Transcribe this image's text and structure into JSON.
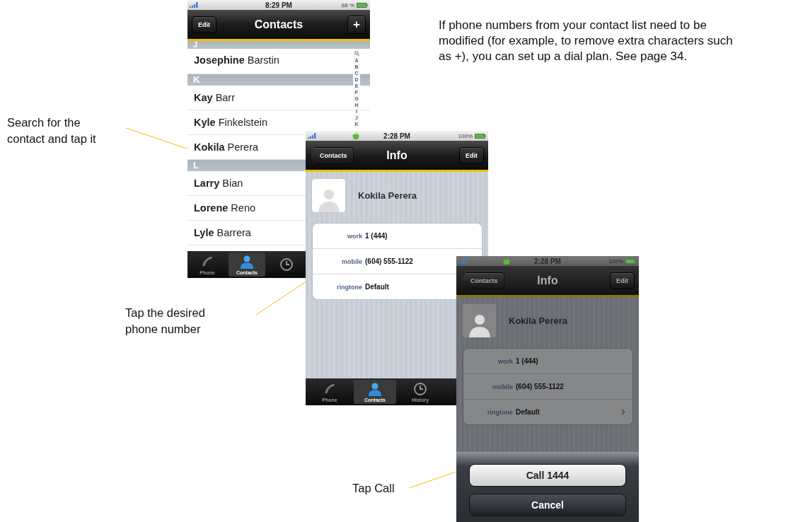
{
  "instructions": "If phone numbers from your contact list need to be modified (for example, to remove extra characters such as +), you can set up a dial plan. See page 34.",
  "callouts": [
    {
      "text": "Search for the contact and tap it"
    },
    {
      "text": "Tap the desired phone number"
    },
    {
      "text": "Tap Call"
    }
  ],
  "screens": [
    {
      "kind": "contacts",
      "dimmed": false,
      "status": {
        "time": "8:29 PM",
        "battery": "88 %",
        "apple_icon": false
      },
      "nav": {
        "left": {
          "label": "Edit",
          "kind": "plain"
        },
        "title": "Contacts",
        "right": {
          "label": "+",
          "kind": "plain"
        }
      },
      "sections": [
        {
          "letter": "J",
          "contacts": [
            "**Josephine** Barstin"
          ]
        },
        {
          "letter": "K",
          "contacts": [
            "**Kay** Barr",
            "**Kyle** Finkelstein",
            "**Kokila** Perera"
          ]
        },
        {
          "letter": "L",
          "contacts": [
            "**Larry** Bian",
            "**Lorene** Reno",
            "**Lyle** Barrera"
          ]
        }
      ],
      "index": [
        "A",
        "B",
        "C",
        "D",
        "E",
        "F",
        "G",
        "H",
        "I",
        "J",
        "K"
      ],
      "tabs": [
        {
          "label": "Phone",
          "selected": false
        },
        {
          "label": "Contacts",
          "selected": true
        },
        {
          "selected": false
        }
      ]
    },
    {
      "kind": "info",
      "dimmed": false,
      "status": {
        "time": "2:28 PM",
        "battery": "100%",
        "apple_icon": true
      },
      "nav": {
        "left": {
          "label": "Contacts",
          "kind": "back"
        },
        "title": "Info",
        "right": {
          "label": "Edit",
          "kind": "plain"
        }
      },
      "name": "Kokila Perera",
      "fields": [
        {
          "label": "work",
          "value": "1 (444)"
        },
        {
          "label": "mobile",
          "value": "(604) 555-1122"
        },
        {
          "label": "ringtone",
          "value": "Default"
        }
      ],
      "tabs": [
        {
          "label": "Phone",
          "selected": false
        },
        {
          "label": "Contacts",
          "selected": true
        },
        {
          "label": "History",
          "selected": false
        }
      ]
    },
    {
      "kind": "info",
      "dimmed": true,
      "status": {
        "time": "2:28 PM",
        "battery": "100%",
        "apple_icon": true
      },
      "nav": {
        "left": {
          "label": "Contacts",
          "kind": "back"
        },
        "title": "Info",
        "right": {
          "label": "Edit",
          "kind": "plain"
        }
      },
      "name": "Kokila Perera",
      "fields": [
        {
          "label": "work",
          "value": "1 (444)",
          "chevron": false
        },
        {
          "label": "mobile",
          "value": "(604) 555-1122",
          "chevron": false
        },
        {
          "label": "ringtone",
          "value": "Default",
          "chevron": true
        }
      ],
      "action_sheet": [
        {
          "label": "Call 1444",
          "kind": "primary"
        },
        {
          "label": "Cancel",
          "kind": "cancel"
        }
      ]
    }
  ]
}
